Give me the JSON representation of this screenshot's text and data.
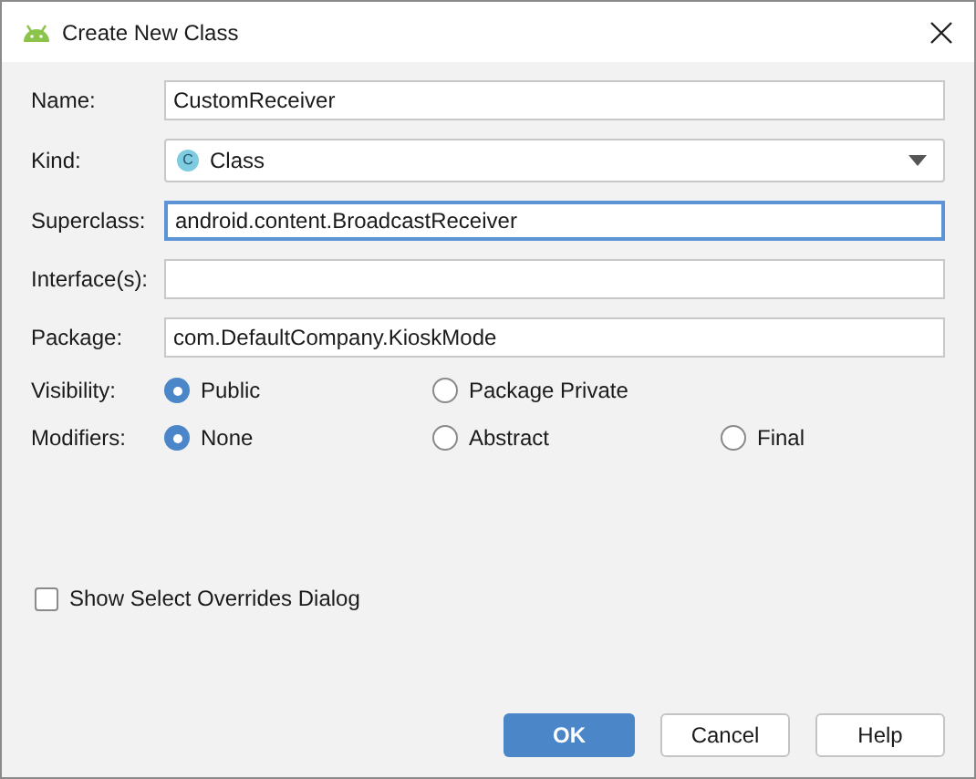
{
  "window": {
    "title": "Create New Class"
  },
  "fields": [
    {
      "label": "Name:",
      "kind": "text",
      "value": "CustomReceiver",
      "focused": false
    },
    {
      "label": "Kind:",
      "kind": "combo",
      "value": "Class",
      "icon_letter": "C",
      "focused": false
    },
    {
      "label": "Superclass:",
      "kind": "text",
      "value": "android.content.BroadcastReceiver",
      "focused": true
    },
    {
      "label": "Interface(s):",
      "kind": "text",
      "focused": false
    },
    {
      "label": "Package:",
      "kind": "text",
      "value": "com.DefaultCompany.KioskMode",
      "focused": false
    }
  ],
  "radio_groups": [
    {
      "label": "Visibility:",
      "options": [
        {
          "label": "Public",
          "selected": true
        },
        {
          "label": "Package Private",
          "selected": false
        }
      ]
    },
    {
      "label": "Modifiers:",
      "options": [
        {
          "label": "None",
          "selected": true
        },
        {
          "label": "Abstract",
          "selected": false
        },
        {
          "label": "Final",
          "selected": false
        }
      ]
    }
  ],
  "show_overrides": {
    "label": "Show Select Overrides Dialog",
    "checked": false
  },
  "buttons": [
    {
      "label": "OK",
      "kind": "default"
    },
    {
      "label": "Cancel",
      "kind": "normal"
    },
    {
      "label": "Help",
      "kind": "normal"
    }
  ]
}
